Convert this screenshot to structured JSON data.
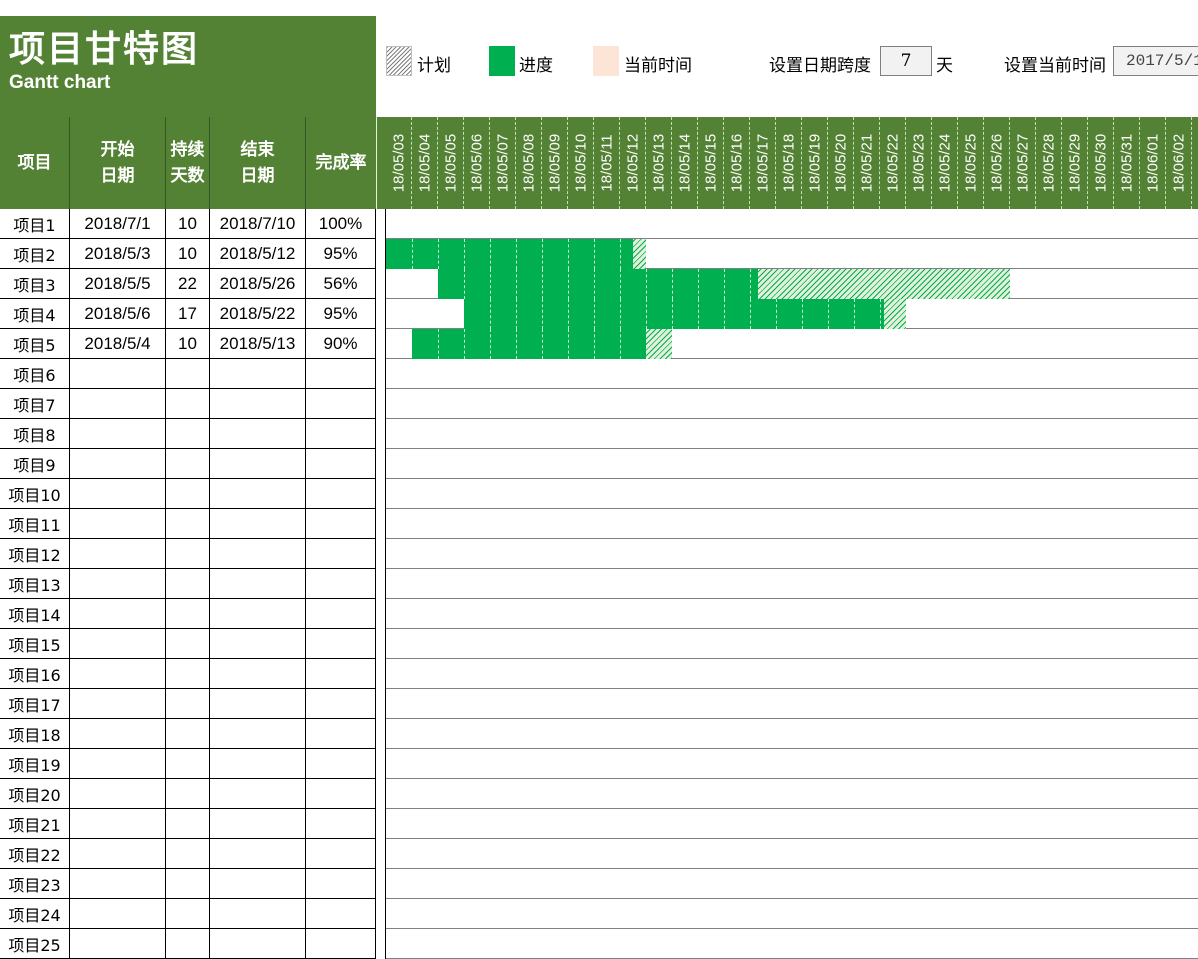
{
  "title": {
    "cn": "项目甘特图",
    "en": "Gantt chart"
  },
  "legend": {
    "plan": "计划",
    "progress": "进度",
    "now": "当前时间"
  },
  "settings": {
    "span_label": "设置日期跨度",
    "span_value": "7",
    "span_unit": "天",
    "current_label": "设置当前时间",
    "current_value": "2017/5/1"
  },
  "colors": {
    "header_green": "#548235",
    "progress_green": "#00b050",
    "now_peach": "#fce4d6"
  },
  "columns": {
    "name": "项目",
    "start": "开始\n日期",
    "duration": "持续\n天数",
    "end": "结束\n日期",
    "completion": "完成率"
  },
  "dates": [
    "18/05/03",
    "18/05/04",
    "18/05/05",
    "18/05/06",
    "18/05/07",
    "18/05/08",
    "18/05/09",
    "18/05/10",
    "18/05/11",
    "18/05/12",
    "18/05/13",
    "18/05/14",
    "18/05/15",
    "18/05/16",
    "18/05/17",
    "18/05/18",
    "18/05/19",
    "18/05/20",
    "18/05/21",
    "18/05/22",
    "18/05/23",
    "18/05/24",
    "18/05/25",
    "18/05/26",
    "18/05/27",
    "18/05/28",
    "18/05/29",
    "18/05/30",
    "18/05/31",
    "18/06/01",
    "18/06/02"
  ],
  "projects": [
    {
      "name": "项目1",
      "start": "2018/7/1",
      "duration": "10",
      "end": "2018/7/10",
      "completion": "100%"
    },
    {
      "name": "项目2",
      "start": "2018/5/3",
      "duration": "10",
      "end": "2018/5/12",
      "completion": "95%"
    },
    {
      "name": "项目3",
      "start": "2018/5/5",
      "duration": "22",
      "end": "2018/5/26",
      "completion": "56%"
    },
    {
      "name": "项目4",
      "start": "2018/5/6",
      "duration": "17",
      "end": "2018/5/22",
      "completion": "95%"
    },
    {
      "name": "项目5",
      "start": "2018/5/4",
      "duration": "10",
      "end": "2018/5/13",
      "completion": "90%"
    },
    {
      "name": "项目6",
      "start": "",
      "duration": "",
      "end": "",
      "completion": ""
    },
    {
      "name": "项目7",
      "start": "",
      "duration": "",
      "end": "",
      "completion": ""
    },
    {
      "name": "项目8",
      "start": "",
      "duration": "",
      "end": "",
      "completion": ""
    },
    {
      "name": "项目9",
      "start": "",
      "duration": "",
      "end": "",
      "completion": ""
    },
    {
      "name": "项目10",
      "start": "",
      "duration": "",
      "end": "",
      "completion": ""
    },
    {
      "name": "项目11",
      "start": "",
      "duration": "",
      "end": "",
      "completion": ""
    },
    {
      "name": "项目12",
      "start": "",
      "duration": "",
      "end": "",
      "completion": ""
    },
    {
      "name": "项目13",
      "start": "",
      "duration": "",
      "end": "",
      "completion": ""
    },
    {
      "name": "项目14",
      "start": "",
      "duration": "",
      "end": "",
      "completion": ""
    },
    {
      "name": "项目15",
      "start": "",
      "duration": "",
      "end": "",
      "completion": ""
    },
    {
      "name": "项目16",
      "start": "",
      "duration": "",
      "end": "",
      "completion": ""
    },
    {
      "name": "项目17",
      "start": "",
      "duration": "",
      "end": "",
      "completion": ""
    },
    {
      "name": "项目18",
      "start": "",
      "duration": "",
      "end": "",
      "completion": ""
    },
    {
      "name": "项目19",
      "start": "",
      "duration": "",
      "end": "",
      "completion": ""
    },
    {
      "name": "项目20",
      "start": "",
      "duration": "",
      "end": "",
      "completion": ""
    },
    {
      "name": "项目21",
      "start": "",
      "duration": "",
      "end": "",
      "completion": ""
    },
    {
      "name": "项目22",
      "start": "",
      "duration": "",
      "end": "",
      "completion": ""
    },
    {
      "name": "项目23",
      "start": "",
      "duration": "",
      "end": "",
      "completion": ""
    },
    {
      "name": "项目24",
      "start": "",
      "duration": "",
      "end": "",
      "completion": ""
    },
    {
      "name": "项目25",
      "start": "",
      "duration": "",
      "end": "",
      "completion": ""
    }
  ]
}
